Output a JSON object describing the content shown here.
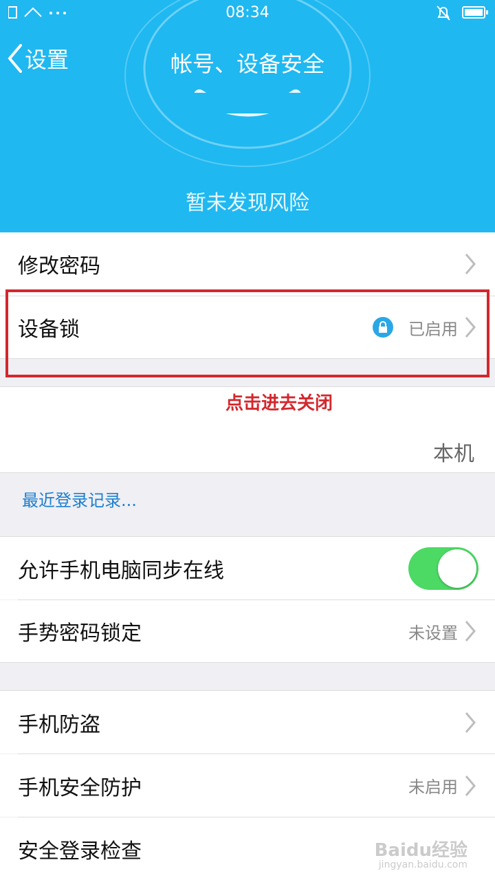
{
  "status_bar": {
    "time": "08:34"
  },
  "header": {
    "back_label": "设置",
    "title": "帐号、设备安全",
    "risk_status": "暂未发现风险",
    "color": "#1fb8f1"
  },
  "rows": {
    "change_password": {
      "label": "修改密码"
    },
    "device_lock": {
      "label": "设备锁",
      "value": "已启用"
    },
    "this_device": {
      "value": "本机"
    },
    "recent_login": {
      "label": "最近登录记录..."
    },
    "sync_online": {
      "label": "允许手机电脑同步在线",
      "toggle": "on"
    },
    "gesture_lock": {
      "label": "手势密码锁定",
      "value": "未设置"
    },
    "anti_theft": {
      "label": "手机防盗"
    },
    "phone_protection": {
      "label": "手机安全防护",
      "value": "未启用"
    },
    "secure_login_check": {
      "label": "安全登录检查"
    }
  },
  "annotation": {
    "text": "点击进去关闭",
    "color": "#d3272d"
  },
  "watermark": {
    "text": "Baidu经验",
    "subtext": "jingyan.baidu.com"
  },
  "icons": [
    "back-chevron-icon",
    "lock-icon",
    "chevron-right-icon",
    "wifi-icon",
    "bell-mute-icon",
    "battery-icon"
  ]
}
